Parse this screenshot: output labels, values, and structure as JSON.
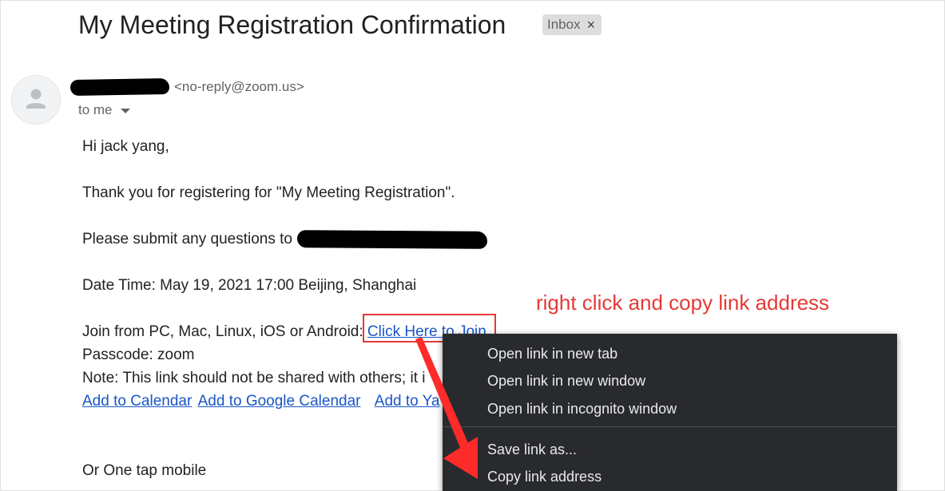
{
  "email": {
    "subject": "My Meeting Registration Confirmation",
    "label": "Inbox",
    "label_close": "×",
    "sender_email": "<no-reply@zoom.us>",
    "recipient": "to me"
  },
  "body": {
    "greeting": "Hi jack yang,",
    "thanks": "Thank you for registering for \"My Meeting Registration\".",
    "questions": "Please submit any questions to",
    "datetime": "Date Time: May 19, 2021 17:00 Beijing, Shanghai",
    "join_prefix": "Join from PC, Mac, Linux, iOS or Android: ",
    "join_link": "Click Here to Join",
    "passcode": "Passcode: zoom",
    "note": "Note: This link should not be shared with others; it i",
    "calendar_links": [
      "Add to Calendar",
      "Add to Google Calendar",
      "Add to Ya"
    ],
    "one_tap": "Or One tap mobile"
  },
  "annotation": {
    "text": "right click and copy link address",
    "color": "#e53935"
  },
  "context_menu": {
    "items": [
      "Open link in new tab",
      "Open link in new window",
      "Open link in incognito window",
      "Save link as...",
      "Copy link address"
    ]
  },
  "icons": {
    "avatar": "person-icon",
    "caret": "chevron-down-icon"
  }
}
